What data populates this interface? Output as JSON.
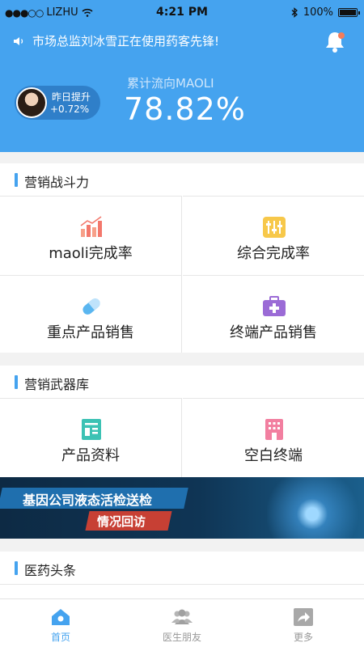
{
  "status": {
    "signal": "●●●○○",
    "carrier": "LIZHU",
    "wifi_icon": "wifi-icon",
    "time": "4:21 PM",
    "bluetooth_icon": "bluetooth-icon",
    "battery": "100%"
  },
  "header": {
    "notice": "市场总监刘冰雪正在使用药客先锋!",
    "growth_label": "昨日提升",
    "growth_value": "+0.72%",
    "metric_label": "累计流向MAOLI",
    "metric_value": "78.82%",
    "accent": "#45a3ef"
  },
  "sections": {
    "combat": {
      "title": "营销战斗力",
      "items": [
        {
          "label": "maoli完成率",
          "icon": "bar-chart-icon"
        },
        {
          "label": "综合完成率",
          "icon": "sliders-icon"
        },
        {
          "label": "重点产品销售",
          "icon": "pill-icon"
        },
        {
          "label": "终端产品销售",
          "icon": "medical-kit-icon"
        }
      ]
    },
    "arsenal": {
      "title": "营销武器库",
      "items": [
        {
          "label": "产品资料",
          "icon": "document-icon"
        },
        {
          "label": "空白终端",
          "icon": "building-icon"
        }
      ]
    },
    "news": {
      "title": "医药头条"
    }
  },
  "banner": {
    "line1": "基因公司液态活检送检",
    "line2": "情况回访"
  },
  "tabs": [
    {
      "label": "首页",
      "icon": "home-icon",
      "active": true
    },
    {
      "label": "医生朋友",
      "icon": "people-icon",
      "active": false
    },
    {
      "label": "更多",
      "icon": "share-icon",
      "active": false
    }
  ]
}
